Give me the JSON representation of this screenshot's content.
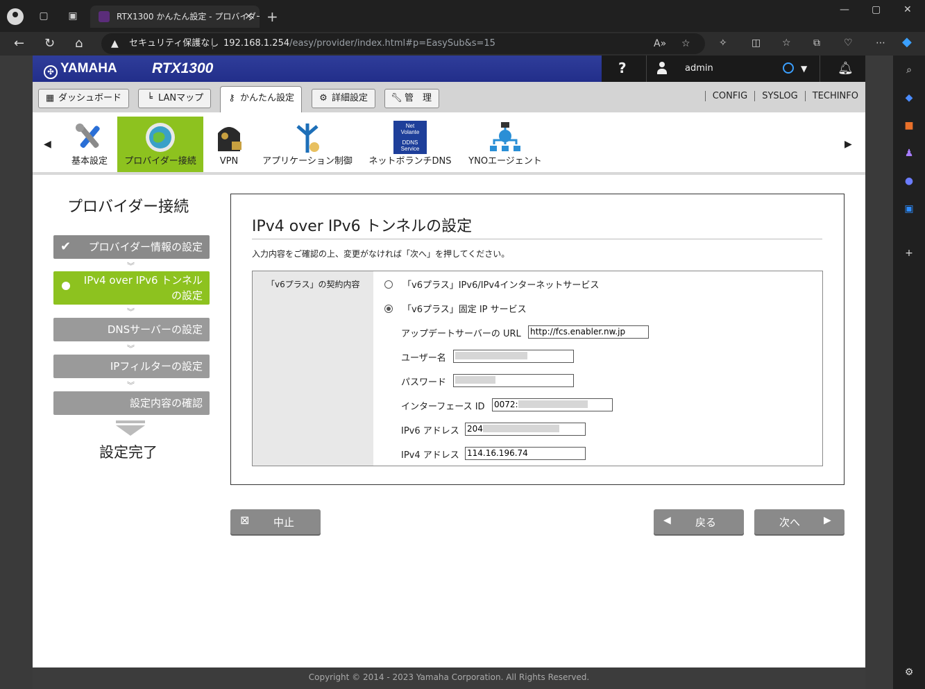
{
  "browser": {
    "tab_title": "RTX1300 かんたん設定 - プロバイダー",
    "security_label": "セキュリティ保護なし",
    "url_host": "192.168.1.254",
    "url_path": "/easy/provider/index.html#p=EasySub&s=15"
  },
  "header": {
    "brand": "YAMAHA",
    "model": "RTX1300",
    "help_label": "?",
    "username": "admin"
  },
  "menu": {
    "dashboard": "ダッシュボード",
    "lanmap": "LANマップ",
    "easy": "かんたん設定",
    "detail": "詳細設定",
    "manage": "管　理",
    "links": [
      "CONFIG",
      "SYSLOG",
      "TECHINFO"
    ]
  },
  "features": [
    {
      "label": "基本設定"
    },
    {
      "label": "プロバイダー接続"
    },
    {
      "label": "VPN"
    },
    {
      "label": "アプリケーション制御"
    },
    {
      "label": "ネットボランチDNS"
    },
    {
      "label": "YNOエージェント"
    }
  ],
  "ddns_icon": {
    "line1": "Net",
    "line2": "Volante",
    "line3": "DDNS",
    "line4": "Service"
  },
  "steps": {
    "title": "プロバイダー接続",
    "items": [
      {
        "label": "プロバイダー情報の設定"
      },
      {
        "label1": "IPv4 over IPv6 トンネル",
        "label2": "の設定"
      },
      {
        "label": "DNSサーバーの設定"
      },
      {
        "label": "IPフィルターの設定"
      },
      {
        "label": "設定内容の確認"
      }
    ],
    "done": "設定完了"
  },
  "panel": {
    "title": "IPv4 over IPv6 トンネルの設定",
    "note": "入力内容をご確認の上、変更がなければ「次へ」を押してください。",
    "field_header": "「v6プラス」の契約内容",
    "option1": "「v6プラス」IPv6/IPv4インターネットサービス",
    "option2": "「v6プラス」固定 IP サービス",
    "url_label": "アップデートサーバーの URL",
    "url_value": "http://fcs.enabler.nw.jp",
    "user_label": "ユーザー名",
    "pass_label": "パスワード",
    "ifid_label": "インターフェース ID",
    "ifid_value": "0072:",
    "ipv6_label": "IPv6 アドレス",
    "ipv6_value": "204",
    "ipv4_label": "IPv4 アドレス",
    "ipv4_value": "114.16.196.74"
  },
  "buttons": {
    "cancel": "中止",
    "back": "戻る",
    "next": "次へ"
  },
  "footer": "Copyright © 2014 - 2023 Yamaha Corporation. All Rights Reserved."
}
